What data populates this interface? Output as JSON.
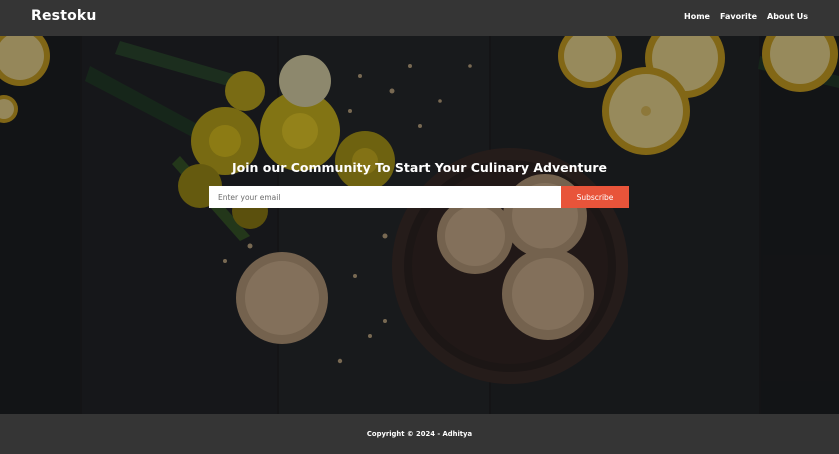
{
  "header": {
    "brand": "Restoku",
    "nav": [
      "Home",
      "Favorite",
      "About Us"
    ]
  },
  "hero": {
    "title": "Join our Community To Start Your Culinary Adventure",
    "email_placeholder": "Enter your email",
    "subscribe_label": "Subscribe"
  },
  "footer": {
    "copyright": "Copyright © 2024 - Adhitya"
  },
  "colors": {
    "header_bg": "#353535",
    "accent": "#e8543a",
    "text": "#ffffff"
  }
}
